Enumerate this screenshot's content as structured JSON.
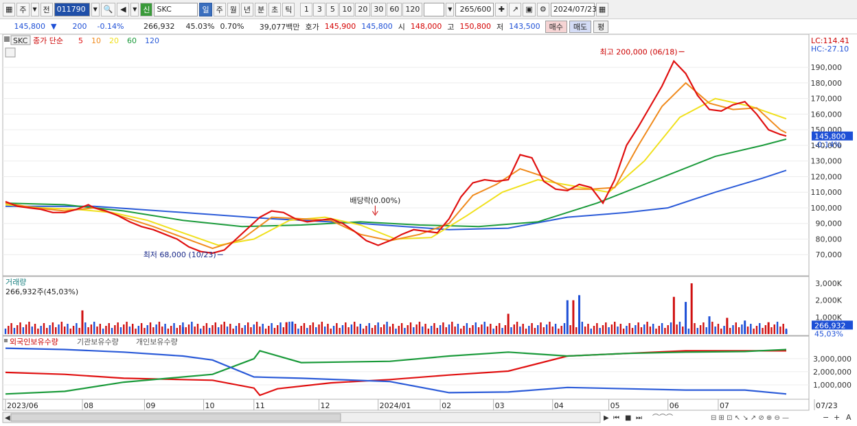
{
  "toolbar": {
    "type_label": "주",
    "prev_label": "전",
    "stock_code": "011790",
    "stock_badge": "신",
    "stock_name": "SKC",
    "periods": [
      "일",
      "주",
      "월",
      "년",
      "분",
      "초",
      "틱"
    ],
    "intervals": [
      "1",
      "3",
      "5",
      "10",
      "20",
      "30",
      "60",
      "120"
    ],
    "count_value": "265",
    "count_max": "/600",
    "date_value": "2024/07/23"
  },
  "quote": {
    "price": "145,800",
    "change": "200",
    "change_pct": "-0.14%",
    "volume": "266,932",
    "volume_ratio": "45.03%",
    "turnover_pct": "0.70%",
    "turnover_amount": "39,077백만",
    "bid_label": "호가",
    "bid_price": "145,900",
    "ask_price": "145,800",
    "open_label": "시",
    "open_price": "148,000",
    "high_label": "고",
    "high_price": "150,800",
    "low_label": "저",
    "low_price": "143,500",
    "buy_label": "매수",
    "sell_label": "매도",
    "eval_label": "평"
  },
  "legend": {
    "name": "SKC",
    "main_label": "종가 단순",
    "ma": [
      {
        "label": "5",
        "color": "#e01010"
      },
      {
        "label": "10",
        "color": "#f08a1c"
      },
      {
        "label": "20",
        "color": "#f0e01c"
      },
      {
        "label": "60",
        "color": "#1a9a3a"
      },
      {
        "label": "120",
        "color": "#2a5ad8"
      }
    ]
  },
  "chart_data": [
    {
      "type": "line",
      "title": "SKC 종가 단순",
      "ylim": [
        60000,
        205000
      ],
      "yticks": [
        "70,000",
        "80,000",
        "90,000",
        "100,000",
        "110,000",
        "120,000",
        "130,000",
        "140,000",
        "150,000",
        "160,000",
        "170,000",
        "180,000",
        "190,000"
      ],
      "x_labels": [
        "2023/06",
        "08",
        "09",
        "10",
        "11",
        "12",
        "2024/01",
        "02",
        "03",
        "04",
        "05",
        "06",
        "07",
        "07/23"
      ],
      "lc_label": "LC:114.41",
      "hc_label": "HC:-27.10",
      "last_price_label": "145,800",
      "last_pct_label": "-0.14%",
      "annotations": {
        "high": "최고 200,000 (06/18)",
        "low": "최저 68,000 (10/23)",
        "dividend": "배당락(0.00%)"
      },
      "series": [
        {
          "name": "5",
          "color": "#e01010",
          "values": [
            [
              0,
              104000
            ],
            [
              4,
              101000
            ],
            [
              8,
              100000
            ],
            [
              12,
              99000
            ],
            [
              16,
              97000
            ],
            [
              20,
              97000
            ],
            [
              24,
              99000
            ],
            [
              28,
              102000
            ],
            [
              30,
              100000
            ],
            [
              34,
              98000
            ],
            [
              38,
              95000
            ],
            [
              42,
              91000
            ],
            [
              46,
              88000
            ],
            [
              50,
              86000
            ],
            [
              54,
              83000
            ],
            [
              58,
              80000
            ],
            [
              62,
              75000
            ],
            [
              66,
              72000
            ],
            [
              70,
              71000
            ],
            [
              74,
              73000
            ],
            [
              78,
              80000
            ],
            [
              82,
              87000
            ],
            [
              86,
              94000
            ],
            [
              90,
              98000
            ],
            [
              94,
              97000
            ],
            [
              98,
              93000
            ],
            [
              102,
              91000
            ],
            [
              106,
              92000
            ],
            [
              110,
              93000
            ],
            [
              114,
              90000
            ],
            [
              118,
              85000
            ],
            [
              122,
              79000
            ],
            [
              126,
              76000
            ],
            [
              130,
              79000
            ],
            [
              134,
              83000
            ],
            [
              138,
              86000
            ],
            [
              142,
              85000
            ],
            [
              146,
              84000
            ],
            [
              150,
              93000
            ],
            [
              154,
              107000
            ],
            [
              158,
              116000
            ],
            [
              162,
              118000
            ],
            [
              166,
              117000
            ],
            [
              170,
              118000
            ],
            [
              174,
              134000
            ],
            [
              178,
              132000
            ],
            [
              182,
              117000
            ],
            [
              186,
              112000
            ],
            [
              190,
              111000
            ],
            [
              194,
              115000
            ],
            [
              198,
              113000
            ],
            [
              202,
              103000
            ],
            [
              206,
              118000
            ],
            [
              210,
              140000
            ],
            [
              214,
              152000
            ],
            [
              218,
              165000
            ],
            [
              222,
              178000
            ],
            [
              226,
              194000
            ],
            [
              230,
              186000
            ],
            [
              234,
              172000
            ],
            [
              238,
              163000
            ],
            [
              242,
              162000
            ],
            [
              246,
              166000
            ],
            [
              250,
              168000
            ],
            [
              254,
              160000
            ],
            [
              258,
              150000
            ],
            [
              262,
              147000
            ],
            [
              264,
              146000
            ]
          ]
        },
        {
          "name": "10",
          "color": "#f08a1c",
          "values": [
            [
              0,
              103000
            ],
            [
              10,
              100000
            ],
            [
              20,
              98000
            ],
            [
              30,
              100000
            ],
            [
              40,
              94000
            ],
            [
              50,
              88000
            ],
            [
              60,
              81000
            ],
            [
              70,
              74000
            ],
            [
              80,
              80000
            ],
            [
              90,
              94000
            ],
            [
              100,
              93000
            ],
            [
              110,
              92000
            ],
            [
              120,
              83000
            ],
            [
              130,
              79000
            ],
            [
              140,
              83000
            ],
            [
              150,
              90000
            ],
            [
              158,
              108000
            ],
            [
              166,
              115000
            ],
            [
              174,
              125000
            ],
            [
              182,
              120000
            ],
            [
              190,
              112000
            ],
            [
              198,
              112000
            ],
            [
              206,
              113000
            ],
            [
              214,
              140000
            ],
            [
              222,
              165000
            ],
            [
              230,
              180000
            ],
            [
              238,
              167000
            ],
            [
              246,
              163000
            ],
            [
              254,
              164000
            ],
            [
              262,
              150000
            ],
            [
              264,
              148000
            ]
          ]
        },
        {
          "name": "20",
          "color": "#f0e01c",
          "values": [
            [
              0,
              102000
            ],
            [
              12,
              100000
            ],
            [
              24,
              99000
            ],
            [
              36,
              97000
            ],
            [
              48,
              92000
            ],
            [
              60,
              84000
            ],
            [
              72,
              76000
            ],
            [
              84,
              80000
            ],
            [
              96,
              92000
            ],
            [
              108,
              94000
            ],
            [
              120,
              89000
            ],
            [
              132,
              80000
            ],
            [
              144,
              81000
            ],
            [
              156,
              95000
            ],
            [
              168,
              110000
            ],
            [
              180,
              118000
            ],
            [
              192,
              114000
            ],
            [
              204,
              110000
            ],
            [
              216,
              130000
            ],
            [
              228,
              158000
            ],
            [
              240,
              170000
            ],
            [
              252,
              165000
            ],
            [
              264,
              157000
            ]
          ]
        },
        {
          "name": "60",
          "color": "#1a9a3a",
          "values": [
            [
              0,
              103000
            ],
            [
              20,
              102000
            ],
            [
              40,
              98000
            ],
            [
              60,
              92000
            ],
            [
              80,
              88000
            ],
            [
              100,
              89000
            ],
            [
              120,
              91000
            ],
            [
              140,
              89000
            ],
            [
              160,
              88000
            ],
            [
              180,
              91000
            ],
            [
              200,
              103000
            ],
            [
              220,
              118000
            ],
            [
              240,
              133000
            ],
            [
              256,
              140000
            ],
            [
              264,
              144000
            ]
          ]
        },
        {
          "name": "120",
          "color": "#2a5ad8",
          "values": [
            [
              0,
              101000
            ],
            [
              30,
              101000
            ],
            [
              60,
              97000
            ],
            [
              90,
              93000
            ],
            [
              120,
              90000
            ],
            [
              150,
              86000
            ],
            [
              170,
              87000
            ],
            [
              190,
              94000
            ],
            [
              210,
              97000
            ],
            [
              224,
              100000
            ],
            [
              240,
              110000
            ],
            [
              256,
              119000
            ],
            [
              264,
              124000
            ]
          ]
        }
      ]
    },
    {
      "type": "bar",
      "title": "거래량",
      "summary": "266,932주(45,03%)",
      "ylim": [
        0,
        3000000
      ],
      "yticks": [
        "1,000K",
        "2,000K",
        "3,000K"
      ],
      "last_value_label": "266,932",
      "last_pct_label": "45,03%",
      "values": [
        [
          26,
          1400000
        ],
        [
          60,
          420000
        ],
        [
          95,
          700000
        ],
        [
          97,
          740000
        ],
        [
          170,
          1200000
        ],
        [
          190,
          2000000
        ],
        [
          192,
          2000000
        ],
        [
          194,
          2300000
        ],
        [
          226,
          2200000
        ],
        [
          230,
          1900000
        ],
        [
          232,
          3000000
        ],
        [
          238,
          1050000
        ],
        [
          244,
          960000
        ],
        [
          250,
          800000
        ],
        [
          258,
          700000
        ],
        [
          264,
          266932
        ]
      ]
    },
    {
      "type": "line",
      "title": "보유수량",
      "ylim": [
        0,
        4200000
      ],
      "yticks": [
        "1,000,000",
        "2,000,000",
        "3,000,000"
      ],
      "x_end_label": "07/23",
      "series": [
        {
          "name": "외국인보유수량",
          "color": "#e01010",
          "values": [
            [
              0,
              1950000
            ],
            [
              20,
              1800000
            ],
            [
              40,
              1500000
            ],
            [
              60,
              1400000
            ],
            [
              70,
              1350000
            ],
            [
              84,
              750000
            ],
            [
              86,
              200000
            ],
            [
              92,
              700000
            ],
            [
              110,
              1150000
            ],
            [
              130,
              1400000
            ],
            [
              150,
              1750000
            ],
            [
              170,
              2050000
            ],
            [
              190,
              3200000
            ],
            [
              210,
              3400000
            ],
            [
              230,
              3600000
            ],
            [
              250,
              3600000
            ],
            [
              264,
              3600000
            ]
          ]
        },
        {
          "name": "기관보유수량",
          "color": "#1a9a3a",
          "values": [
            [
              0,
              300000
            ],
            [
              20,
              500000
            ],
            [
              40,
              1200000
            ],
            [
              60,
              1600000
            ],
            [
              70,
              1800000
            ],
            [
              84,
              3000000
            ],
            [
              86,
              3600000
            ],
            [
              100,
              2700000
            ],
            [
              130,
              2800000
            ],
            [
              150,
              3200000
            ],
            [
              170,
              3500000
            ],
            [
              190,
              3200000
            ],
            [
              210,
              3400000
            ],
            [
              230,
              3500000
            ],
            [
              250,
              3550000
            ],
            [
              264,
              3700000
            ]
          ]
        },
        {
          "name": "개인보유수량",
          "color": "#2a5ad8",
          "values": [
            [
              0,
              3800000
            ],
            [
              20,
              3700000
            ],
            [
              40,
              3500000
            ],
            [
              60,
              3200000
            ],
            [
              70,
              2900000
            ],
            [
              84,
              1600000
            ],
            [
              100,
              1500000
            ],
            [
              130,
              1250000
            ],
            [
              150,
              400000
            ],
            [
              170,
              450000
            ],
            [
              190,
              800000
            ],
            [
              210,
              700000
            ],
            [
              230,
              600000
            ],
            [
              250,
              600000
            ],
            [
              264,
              300000
            ]
          ]
        }
      ]
    }
  ]
}
